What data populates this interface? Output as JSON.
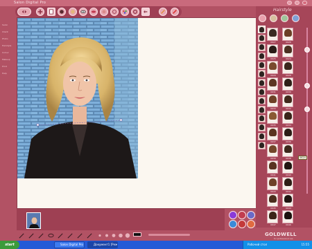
{
  "app": {
    "title": "Salon Digital Pro",
    "panel_title": "Hairstyle",
    "brand": "GOLDWELL",
    "brand_sub": "for professional use"
  },
  "left_menu": {
    "items": [
      "Salon",
      "Client",
      "Photo",
      "Hairstyle",
      "Colour",
      "Makeup",
      "Print",
      "Help",
      "Exit"
    ]
  },
  "right_panel": {
    "tooltip": "0624",
    "hair_cards": [
      {
        "code": "0627",
        "color": "#3a2a22"
      },
      {
        "code": "0626",
        "color": "#6b3f26"
      },
      {
        "code": "0625",
        "color": "#2a1c17"
      },
      {
        "code": "0624",
        "color": "#4b3021"
      },
      {
        "code": "0629",
        "color": "#7a4a2e"
      },
      {
        "code": "0628",
        "color": "#3b271d"
      },
      {
        "code": "0631",
        "color": "#5c3522"
      },
      {
        "code": "0630",
        "color": "#2f2018"
      },
      {
        "code": "0633",
        "color": "#6e4027"
      },
      {
        "code": "0632",
        "color": "#41291c"
      },
      {
        "code": "0635",
        "color": "#8a5a33"
      },
      {
        "code": "0634",
        "color": "#3a241a"
      },
      {
        "code": "0637",
        "color": "#5a3420"
      },
      {
        "code": "0636",
        "color": "#2c1d16"
      },
      {
        "code": "0639",
        "color": "#73462a"
      },
      {
        "code": "0638",
        "color": "#3d281c"
      },
      {
        "code": "0641",
        "color": "#5a3320"
      },
      {
        "code": "0640",
        "color": "#221612"
      },
      {
        "code": "0643",
        "color": "#6e4128"
      },
      {
        "code": "0642",
        "color": "#2e1e16"
      },
      {
        "code": "0645",
        "color": "#4c2d1d"
      },
      {
        "code": "0644",
        "color": "#1f1410"
      },
      {
        "code": "0647",
        "color": "#3d2619"
      },
      {
        "code": "0646",
        "color": "#1c120e"
      }
    ]
  },
  "taskbar": {
    "start": "start",
    "tasks": [
      "Salon Digital Pro",
      "Документ1 [Режим..."
    ],
    "tray_label": "Рабочий стол",
    "clock": "15:55"
  },
  "colors": {
    "frame": "#b25264",
    "canvas": "#fbf7f0",
    "taskbar": "#245ad7"
  }
}
